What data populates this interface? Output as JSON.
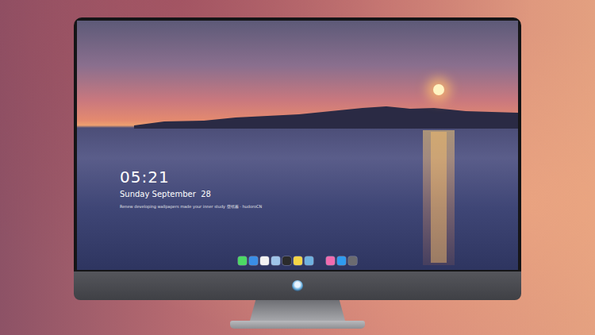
{
  "clock": {
    "time": "05:21",
    "date": "Sunday September  28",
    "caption": "Renew developing wallpapers made your inner study 壁纸酱 · hudoroCN"
  },
  "dock": {
    "groups": [
      {
        "apps": [
          {
            "color": "#4cd964"
          },
          {
            "color": "#3a8ee6"
          },
          {
            "color": "#f2f2f2"
          },
          {
            "color": "#9fc4e8"
          },
          {
            "color": "#2b2b2b"
          },
          {
            "color": "#f5d547"
          },
          {
            "color": "#6fb1e0"
          }
        ]
      },
      {
        "apps": [
          {
            "color": "#f06bb0"
          },
          {
            "color": "#2f9bf0"
          },
          {
            "color": "#6b6b70"
          }
        ]
      }
    ]
  }
}
